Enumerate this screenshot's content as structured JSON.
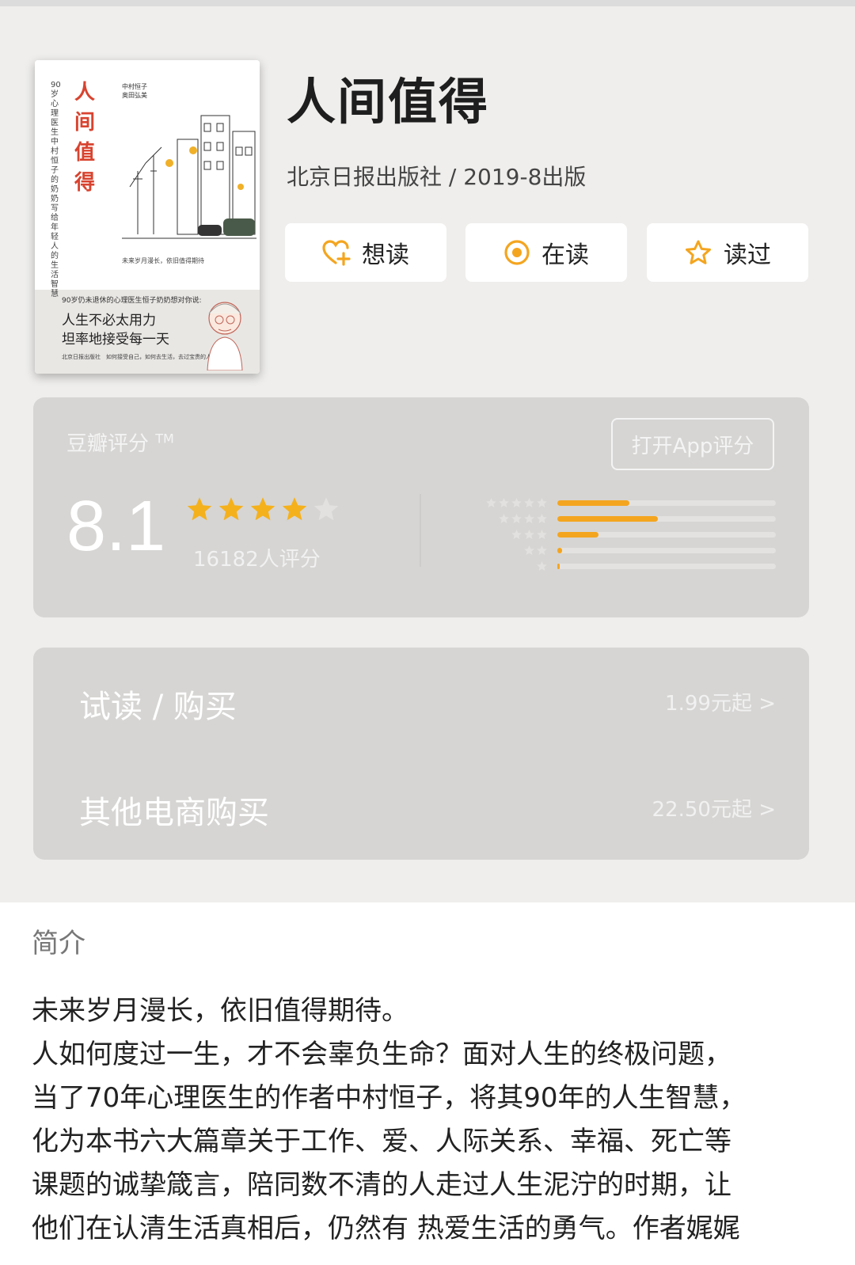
{
  "book": {
    "title": "人间值得",
    "meta": "北京日报出版社 / 2019-8出版",
    "cover": {
      "title_chars": [
        "人",
        "间",
        "值",
        "得"
      ],
      "subtitle": "90岁心理医生中村恒子的奶奶写给年轻人的生活智慧",
      "authors": [
        "中村恒子",
        "奥田弘美"
      ],
      "tag": "未来岁月漫长，依旧值得期待",
      "tagline_small": "90岁仍未退休的心理医生恒子奶奶想对你说:",
      "tagline_1": "人生不必太用力",
      "tagline_2": "坦率地接受每一天",
      "footer": "北京日报出版社　如何接受自己，如何去生活，去过宝贵的人生。"
    }
  },
  "actions": [
    {
      "label": "想读",
      "icon": "heart-plus-icon"
    },
    {
      "label": "在读",
      "icon": "target-icon"
    },
    {
      "label": "读过",
      "icon": "star-outline-icon"
    }
  ],
  "rating": {
    "label": "豆瓣评分",
    "trademark": "TM",
    "open_app": "打开App评分",
    "score": "8.1",
    "stars": 4,
    "count_text": "16182人评分",
    "distribution": [
      {
        "stars": 5,
        "percent": 33
      },
      {
        "stars": 4,
        "percent": 46
      },
      {
        "stars": 3,
        "percent": 19
      },
      {
        "stars": 2,
        "percent": 2
      },
      {
        "stars": 1,
        "percent": 0.5
      }
    ],
    "colors": {
      "star": "#f5b11c",
      "star_empty": "#e2e1df",
      "bar": "#f4a51f"
    }
  },
  "buy": [
    {
      "label": "试读 / 购买",
      "price": "1.99元起 >"
    },
    {
      "label": "其他电商购买",
      "price": "22.50元起 >"
    }
  ],
  "intro": {
    "title": "简介",
    "lines": [
      "未来岁月漫长，依旧值得期待。",
      "人如何度过一生，才不会辜负生命？面对人生的终极问题，",
      "当了70年心理医生的作者中村恒子，将其90年的人生智慧，",
      "化为本书六大篇章关于工作、爱、人际关系、幸福、死亡等",
      "课题的诚挚箴言，陪同数不清的人走过人生泥泞的时期，让",
      "他们在认清生活真相后，仍然有 热爱生活的勇气。作者娓娓"
    ]
  }
}
